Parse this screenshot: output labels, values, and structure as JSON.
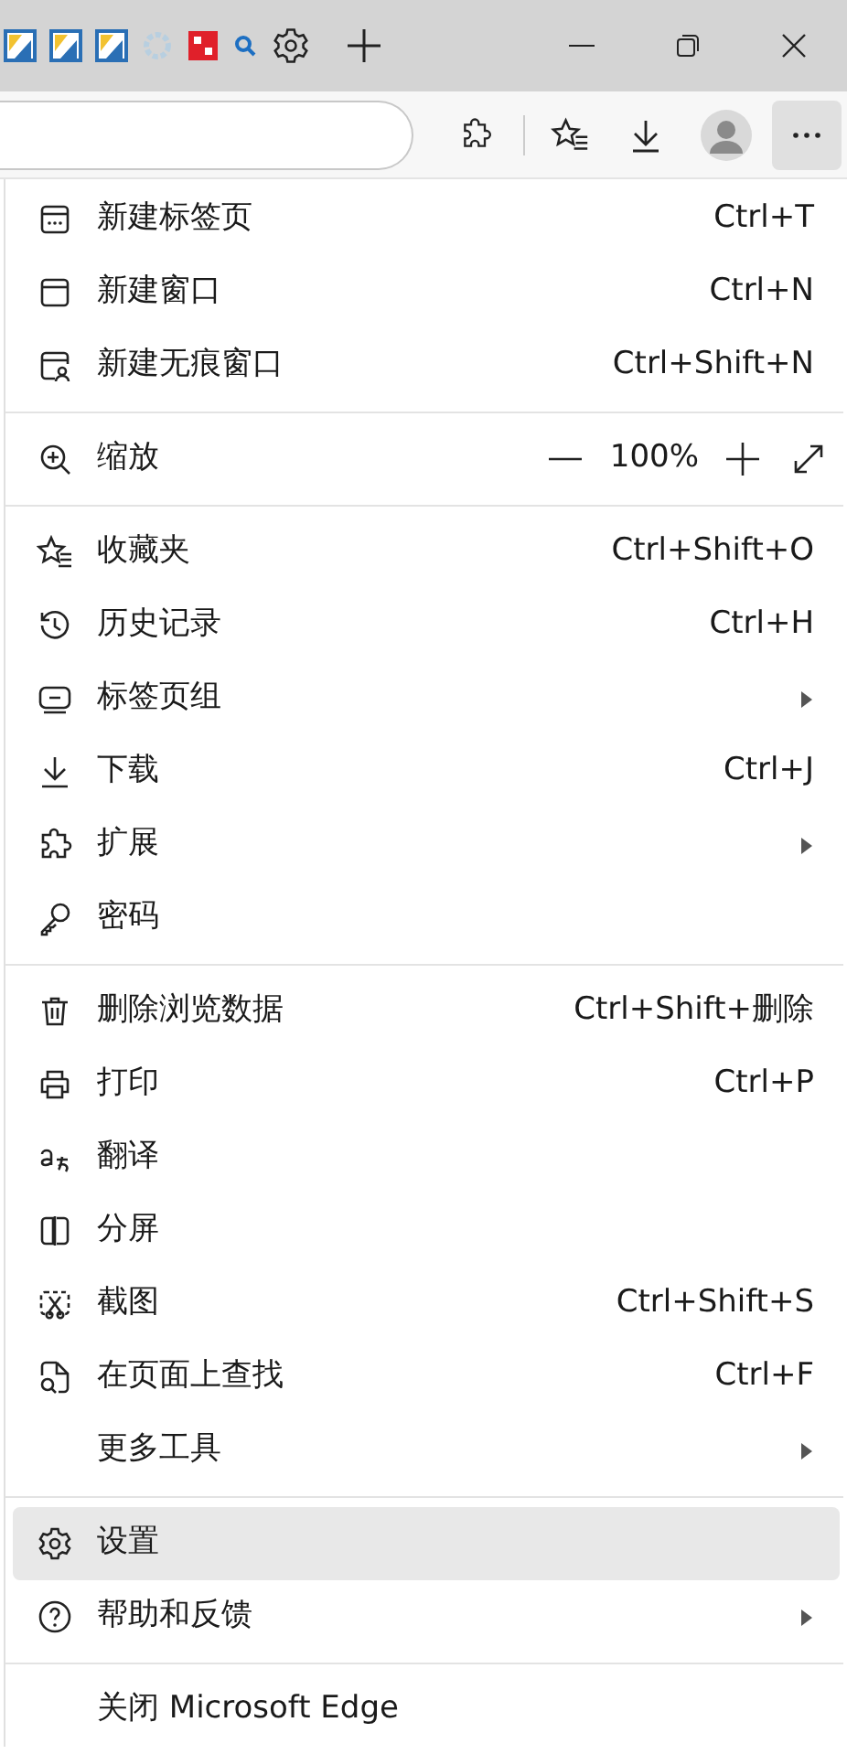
{
  "menu": {
    "groups": [
      {
        "items": [
          {
            "kind": "command",
            "label": "新建标签页",
            "shortcut": "Ctrl+T",
            "highlighted": false
          },
          {
            "kind": "command",
            "label": "新建窗口",
            "shortcut": "Ctrl+N",
            "highlighted": false
          },
          {
            "kind": "command",
            "label": "新建无痕窗口",
            "shortcut": "Ctrl+Shift+N",
            "highlighted": false
          }
        ]
      },
      {
        "items": [
          {
            "kind": "zoom",
            "label": "缩放",
            "value": "100%",
            "highlighted": false
          }
        ]
      },
      {
        "items": [
          {
            "kind": "command",
            "label": "收藏夹",
            "shortcut": "Ctrl+Shift+O",
            "highlighted": false
          },
          {
            "kind": "command",
            "label": "历史记录",
            "shortcut": "Ctrl+H",
            "highlighted": false
          },
          {
            "kind": "submenu",
            "label": "标签页组",
            "highlighted": false
          },
          {
            "kind": "command",
            "label": "下载",
            "shortcut": "Ctrl+J",
            "highlighted": false
          },
          {
            "kind": "submenu",
            "label": "扩展",
            "highlighted": false
          },
          {
            "kind": "command",
            "label": "密码",
            "highlighted": false
          }
        ]
      },
      {
        "items": [
          {
            "kind": "command",
            "label": "删除浏览数据",
            "shortcut": "Ctrl+Shift+删除",
            "highlighted": false
          },
          {
            "kind": "command",
            "label": "打印",
            "shortcut": "Ctrl+P",
            "highlighted": false
          },
          {
            "kind": "command",
            "label": "翻译",
            "highlighted": false
          },
          {
            "kind": "command",
            "label": "分屏",
            "highlighted": false
          },
          {
            "kind": "command",
            "label": "截图",
            "shortcut": "Ctrl+Shift+S",
            "highlighted": false
          },
          {
            "kind": "command",
            "label": "在页面上查找",
            "shortcut": "Ctrl+F",
            "highlighted": false
          },
          {
            "kind": "submenu",
            "label": "更多工具",
            "highlighted": false
          }
        ]
      },
      {
        "items": [
          {
            "kind": "command",
            "label": "设置",
            "highlighted": true
          },
          {
            "kind": "submenu",
            "label": "帮助和反馈",
            "highlighted": false
          }
        ]
      },
      {
        "items": [
          {
            "kind": "command",
            "label": "关闭 Microsoft Edge",
            "highlighted": false
          }
        ]
      }
    ]
  }
}
